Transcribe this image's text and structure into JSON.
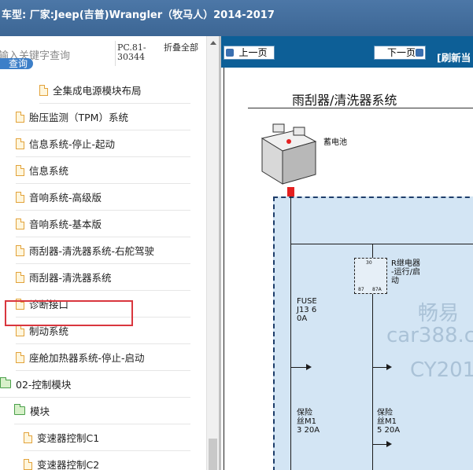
{
  "header": {
    "title": "车型:  厂家:Jeep(吉普)Wrangler（牧马人）2014-2017"
  },
  "search": {
    "placeholder": "输入关键字查询",
    "button_label": "查询",
    "pc_code": "PC.81-30344",
    "collapse_all_label": "折叠全部"
  },
  "tree": {
    "items": [
      {
        "label": "全集成电源模块布局",
        "type": "file"
      },
      {
        "label": "胎压监测（TPM）系统",
        "type": "file"
      },
      {
        "label": "信息系统-停止-起动",
        "type": "file"
      },
      {
        "label": "信息系统",
        "type": "file"
      },
      {
        "label": "音响系统-高级版",
        "type": "file"
      },
      {
        "label": "音响系统-基本版",
        "type": "file"
      },
      {
        "label": "雨刮器-清洗器系统-右舵驾驶",
        "type": "file"
      },
      {
        "label": "雨刮器-清洗器系统",
        "type": "file"
      },
      {
        "label": "诊断接口",
        "type": "file"
      },
      {
        "label": "制动系统",
        "type": "file"
      },
      {
        "label": "座舱加热器系统-停止-启动",
        "type": "file"
      },
      {
        "label": "02-控制模块",
        "type": "folder"
      },
      {
        "label": "模块",
        "type": "folder"
      },
      {
        "label": "变速器控制C1",
        "type": "file"
      },
      {
        "label": "变速器控制C2",
        "type": "file"
      }
    ]
  },
  "viewer": {
    "prev_label": "上一页",
    "next_label": "下一页",
    "refresh_label": "[刷新当",
    "diagram": {
      "title": "雨刮器/清洗器系统",
      "battery_label": "蓄电池",
      "fuse1": [
        "FUSE",
        "J13 6",
        "0A"
      ],
      "relay_label": [
        "R继电器",
        "-运行/启",
        "动"
      ],
      "relay_pins": [
        "30",
        "87",
        "87A"
      ],
      "fuse2": [
        "保险",
        "丝M1",
        "3 20A"
      ],
      "fuse3": [
        "保险",
        "丝M1",
        "5 20A"
      ],
      "watermark": [
        "畅易",
        "car388.c",
        "CY201"
      ]
    }
  },
  "colors": {
    "header_bg": "#4470a0",
    "nav_bg": "#0d5f97",
    "highlight": "#d9363e",
    "fuse_box_bg": "#d3e5f4"
  }
}
